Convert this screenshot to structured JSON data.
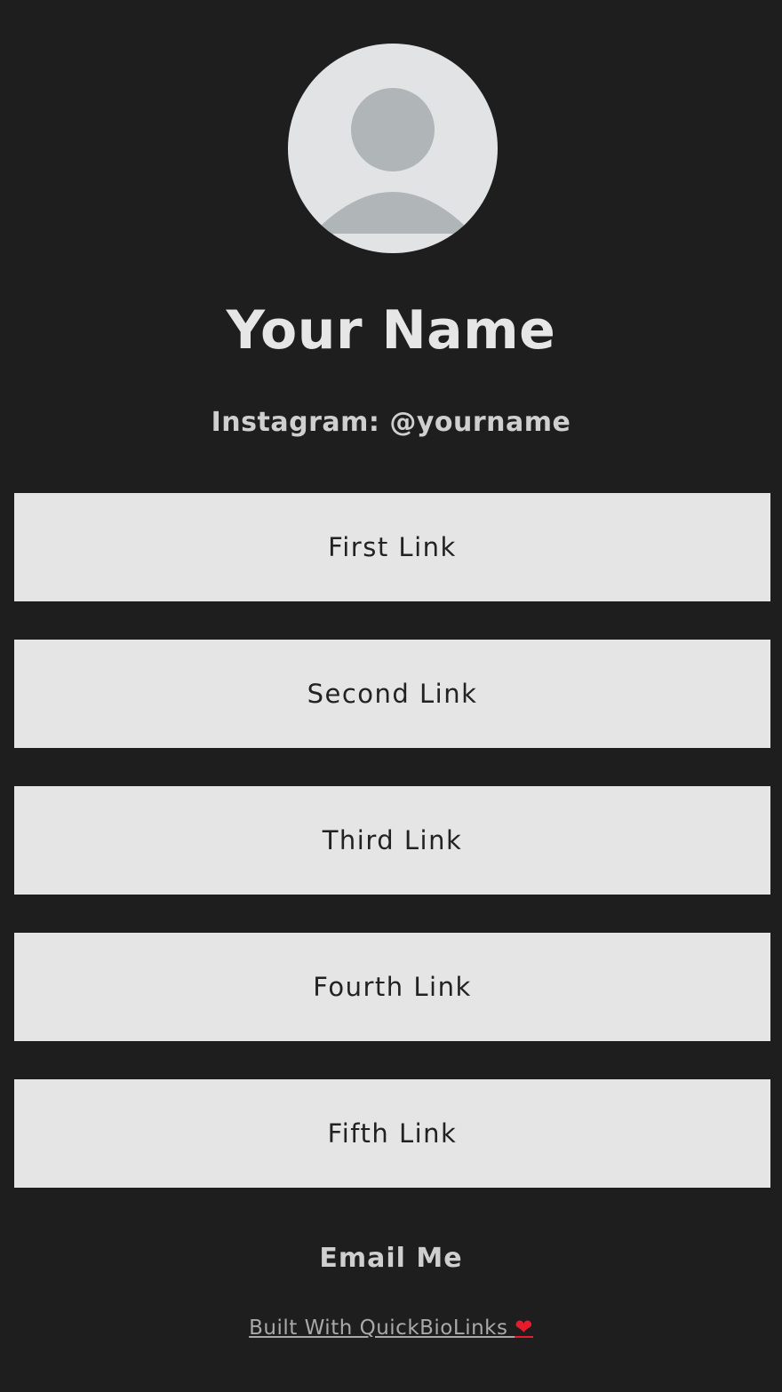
{
  "profile": {
    "name": "Your Name",
    "handle": "Instagram: @yourname"
  },
  "links": [
    {
      "label": "First Link"
    },
    {
      "label": "Second Link"
    },
    {
      "label": "Third Link"
    },
    {
      "label": "Fourth Link"
    },
    {
      "label": "Fifth Link"
    }
  ],
  "footer": {
    "email_label": "Email Me",
    "built_with": "Built With QuickBioLinks",
    "heart_icon": "❤"
  },
  "colors": {
    "background": "#1e1e1e",
    "button_bg": "#e5e5e5",
    "avatar_bg": "#e2e3e5",
    "avatar_figure": "#b0b5b7",
    "heart": "#e81b2d"
  }
}
